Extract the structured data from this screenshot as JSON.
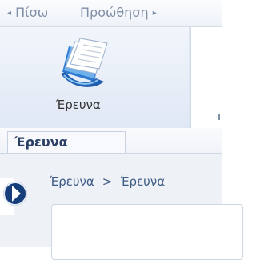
{
  "nav": {
    "back_label": "Πίσω",
    "forward_label": "Προώθηση",
    "back_arrow": "◂",
    "forward_arrow": "▸"
  },
  "ribbon": {
    "search_button_label": "Έρευνα",
    "search_icon": "documents-icon"
  },
  "tabs": [
    {
      "label": "Έρευνα",
      "selected": true
    }
  ],
  "breadcrumb": {
    "items": [
      "Έρευνα",
      "Έρευνα"
    ],
    "separator": ">"
  },
  "colors": {
    "accent": "#163e7a",
    "ribbon_bg": "#dde6f3",
    "link": "#3d5b85"
  }
}
